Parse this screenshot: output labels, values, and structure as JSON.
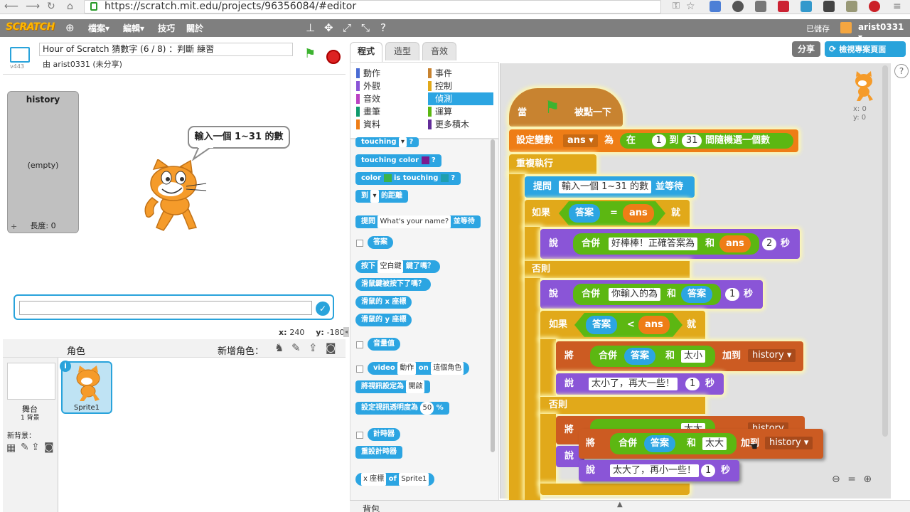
{
  "browser": {
    "url": "https://scratch.mit.edu/projects/96356084/#editor",
    "icons": [
      "back-icon",
      "forward-icon",
      "reload-icon",
      "home-icon",
      "lock-icon",
      "key-icon",
      "star-icon"
    ]
  },
  "menubar": {
    "logo": "SCRATCH",
    "items": [
      "檔案▾",
      "編輯▾",
      "技巧",
      "關於"
    ],
    "saved": "已儲存",
    "user": "arist0331 ▾"
  },
  "project": {
    "title": "Hour of Scratch 猜數字 (6 / 8) ：判斷 練習",
    "byline": "由 arist0331 (未分享)",
    "version": "v443"
  },
  "header_buttons": {
    "share": "分享",
    "see_page": "檢視專案頁面"
  },
  "stage": {
    "list_title": "history",
    "list_empty": "(empty)",
    "list_length": "長度: 0",
    "list_plus": "+",
    "bubble": "輸入一個 1~31 的數",
    "coords_x_label": "x:",
    "coords_x": "240",
    "coords_y_label": "y:",
    "coords_y": "-180"
  },
  "sprites": {
    "header": "角色",
    "new_sprite": "新增角色：",
    "stage_label": "舞台",
    "stage_sub": "1 背景",
    "new_backdrop": "新背景：",
    "sprite_name": "Sprite1",
    "info": "i"
  },
  "tabs": [
    "程式",
    "造型",
    "音效"
  ],
  "categories": {
    "left": [
      {
        "label": "動作",
        "color": "#4a6cd4"
      },
      {
        "label": "外觀",
        "color": "#8a55d7"
      },
      {
        "label": "音效",
        "color": "#bb42c3"
      },
      {
        "label": "畫筆",
        "color": "#0e9a6c"
      },
      {
        "label": "資料",
        "color": "#ee7d16"
      }
    ],
    "right": [
      {
        "label": "事件",
        "color": "#c88330"
      },
      {
        "label": "控制",
        "color": "#e1a91a"
      },
      {
        "label": "偵測",
        "color": "#2ca5e2"
      },
      {
        "label": "運算",
        "color": "#5cb712"
      },
      {
        "label": "更多積木",
        "color": "#632d99"
      }
    ],
    "selected": "偵測"
  },
  "palette": {
    "touching": "touching",
    "touching_color": "touching color",
    "color_word": "color",
    "is_touching": "is touching",
    "q": "?",
    "to": "到",
    "distance": "的距離",
    "ask": "提問",
    "ask_default": "What's your name?",
    "and_wait": "並等待",
    "answer": "答案",
    "key_pressed_a": "按下",
    "key_space": "空白鍵",
    "key_pressed_b": "鍵了嗎？",
    "mouse_down": "滑鼠鍵被按下了嗎？",
    "mouse_x": "滑鼠的 x 座標",
    "mouse_y": "滑鼠的 y 座標",
    "loudness": "音量值",
    "video": "video",
    "video_motion": "動作",
    "video_on": "on",
    "video_sprite": "這個角色",
    "video_set": "將視訊設定為",
    "video_state": "開啟",
    "video_transp": "設定視訊透明度為",
    "video_transp_val": "50",
    "percent": "%",
    "timer": "計時器",
    "reset_timer": "重設計時器",
    "xpos": "x 座標",
    "of": "of",
    "sprite1": "Sprite1"
  },
  "script": {
    "when": "當",
    "clicked": "被點一下",
    "set_var": "設定變數",
    "var": "ans",
    "to_word": "為",
    "pick_in": "在",
    "pick_min": "1",
    "pick_to": "到",
    "pick_max": "31",
    "pick_end": "間隨機選一個數",
    "forever": "重複執行",
    "ask": "提問",
    "ask_text": "輸入一個 1~31 的數",
    "and_wait": "並等待",
    "if": "如果",
    "then": "就",
    "else": "否則",
    "answer": "答案",
    "eq": "=",
    "lt": "<",
    "say": "說",
    "join": "合併",
    "and_word": "和",
    "correct": "好棒棒！正確答案為",
    "secs": "秒",
    "two": "2",
    "one": "1",
    "you_input": "你輸入的為",
    "add_word": "將",
    "add_to": "加到",
    "list": "history",
    "too_small": "太小",
    "too_small_say": "太小了，再大一些！",
    "too_big": "太大",
    "too_big_say": "太大了，再小一些！",
    "hidden_too_big": "太大",
    "hidden_list": "history"
  },
  "sprite_info": {
    "x": "x: 0",
    "y": "y: 0"
  },
  "bottom": {
    "backpack": "背包"
  }
}
